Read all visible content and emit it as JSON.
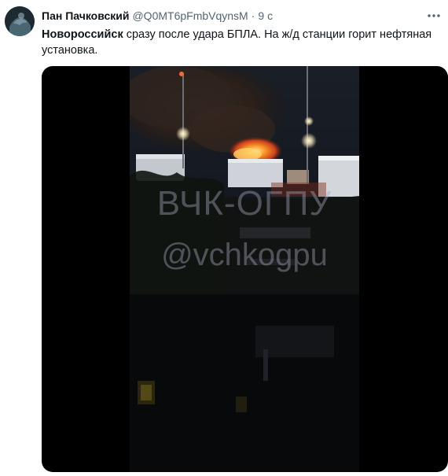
{
  "tweet": {
    "display_name": "Пан Пачковский",
    "handle": "@Q0MT6pFmbVqynsM",
    "separator": "·",
    "time": "9 с",
    "text_bold": "Новороссийск",
    "text_rest": " сразу после удара БПЛА. На ж/д станции горит нефтяная установка.",
    "more_icon": "more-horizontal-icon"
  },
  "media": {
    "watermark_line1": "ВЧК-ОГПУ",
    "watermark_line2": "@vchkogpu"
  }
}
